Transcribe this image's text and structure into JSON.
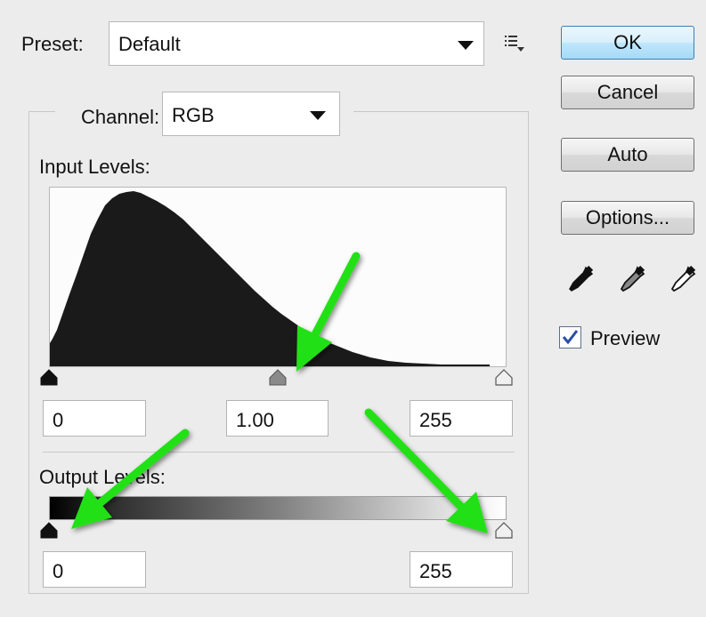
{
  "preset": {
    "label": "Preset:",
    "value": "Default"
  },
  "channel": {
    "label": "Channel:",
    "value": "RGB"
  },
  "input_levels": {
    "label": "Input Levels:",
    "black": "0",
    "gamma": "1.00",
    "white": "255"
  },
  "output_levels": {
    "label": "Output Levels:",
    "black": "0",
    "white": "255"
  },
  "buttons": {
    "ok": "OK",
    "cancel": "Cancel",
    "auto": "Auto",
    "options": "Options..."
  },
  "preview": {
    "label": "Preview",
    "checked": true
  },
  "icons": {
    "preset_menu": "preset-options-icon",
    "eyedroppers": [
      "black-point-eyedropper-icon",
      "gray-point-eyedropper-icon",
      "white-point-eyedropper-icon"
    ],
    "annotation_arrows": [
      "green-arrow-icon",
      "green-arrow-icon",
      "green-arrow-icon"
    ]
  },
  "colors": {
    "annotation_arrow": "#22e014",
    "histogram_fill": "#1a1a1a",
    "primary_button_border": "#3c7fb1"
  }
}
